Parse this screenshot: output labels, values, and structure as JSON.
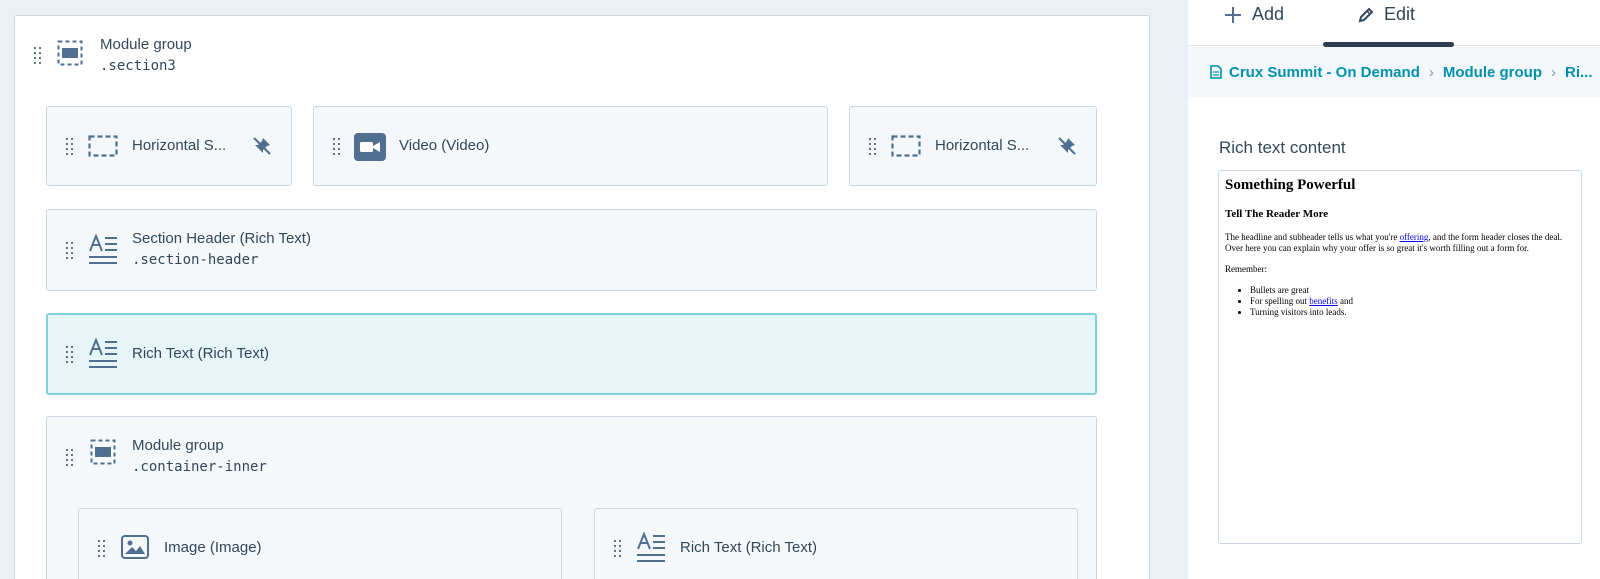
{
  "outer_group": {
    "title": "Module group",
    "class_name": ".section3"
  },
  "row1": [
    {
      "label": "Horizontal S...",
      "icon": "dashed-rect-icon",
      "trailing_icon": "unpin-icon"
    },
    {
      "label": "Video (Video)",
      "icon": "video-icon"
    },
    {
      "label": "Horizontal S...",
      "icon": "dashed-rect-icon",
      "trailing_icon": "unpin-icon"
    }
  ],
  "section_header": {
    "title": "Section Header (Rich Text)",
    "class_name": ".section-header",
    "icon": "rich-text-icon"
  },
  "rich_text_active": {
    "title": "Rich Text (Rich Text)",
    "icon": "rich-text-icon"
  },
  "inner_group": {
    "title": "Module group",
    "class_name": ".container-inner",
    "icon": "module-group-icon",
    "children": [
      {
        "label": "Image (Image)",
        "icon": "image-icon"
      },
      {
        "label": "Rich Text (Rich Text)",
        "icon": "rich-text-icon"
      }
    ]
  },
  "panel": {
    "tabs": [
      {
        "label": "Add",
        "icon": "plus-icon"
      },
      {
        "label": "Edit",
        "icon": "pencil-icon",
        "active": true
      }
    ],
    "breadcrumb": [
      "Crux Summit - On Demand",
      "Module group",
      "Ri..."
    ],
    "field_label": "Rich text content",
    "editor": {
      "heading": "Something Powerful",
      "subheading": "Tell The Reader More",
      "para1_before": "The headline and subheader tells us what you're ",
      "para1_link": "offering",
      "para1_after": ", and the form header closes the deal. Over here you can explain why your offer is so great it's worth filling out a form for.",
      "para2": "Remember:",
      "bullets": {
        "b1": "Bullets are great",
        "b2_before": "For spelling out ",
        "b2_link": "benefits",
        "b2_after": " and",
        "b3": "Turning visitors into leads."
      }
    }
  },
  "colors": {
    "accent_teal": "#0091ae",
    "active_bg": "#e5f5f8",
    "active_border": "#7fd1de",
    "text": "#33475b"
  }
}
